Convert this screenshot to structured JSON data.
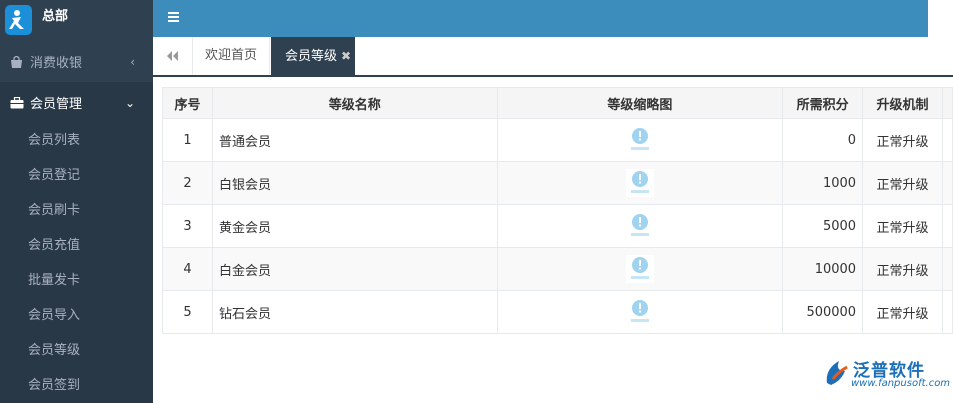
{
  "brand": {
    "name": "总部"
  },
  "sidebar": {
    "groups": [
      {
        "label": "消费收银",
        "arrow": "‹"
      },
      {
        "label": "会员管理",
        "arrow": "⌄"
      }
    ],
    "items": [
      {
        "label": "会员列表"
      },
      {
        "label": "会员登记"
      },
      {
        "label": "会员刷卡"
      },
      {
        "label": "会员充值"
      },
      {
        "label": "批量发卡"
      },
      {
        "label": "会员导入"
      },
      {
        "label": "会员等级"
      },
      {
        "label": "会员签到"
      }
    ]
  },
  "tabs": {
    "items": [
      {
        "label": "欢迎首页"
      },
      {
        "label": "会员等级",
        "close": "✖"
      }
    ]
  },
  "table": {
    "headers": [
      "序号",
      "等级名称",
      "等级缩略图",
      "所需积分",
      "升级机制"
    ],
    "rows": [
      {
        "no": "1",
        "name": "普通会员",
        "points": "0",
        "mechanism": "正常升级"
      },
      {
        "no": "2",
        "name": "白银会员",
        "points": "1000",
        "mechanism": "正常升级"
      },
      {
        "no": "3",
        "name": "黄金会员",
        "points": "5000",
        "mechanism": "正常升级"
      },
      {
        "no": "4",
        "name": "白金会员",
        "points": "10000",
        "mechanism": "正常升级"
      },
      {
        "no": "5",
        "name": "钻石会员",
        "points": "500000",
        "mechanism": "正常升级"
      }
    ]
  },
  "watermark": {
    "title": "泛普软件",
    "url": "www.fanpusoft.com"
  },
  "colors": {
    "sidebar": "#2f4050",
    "header": "#3c8dbc",
    "brand_accent": "#1b6fb8"
  }
}
